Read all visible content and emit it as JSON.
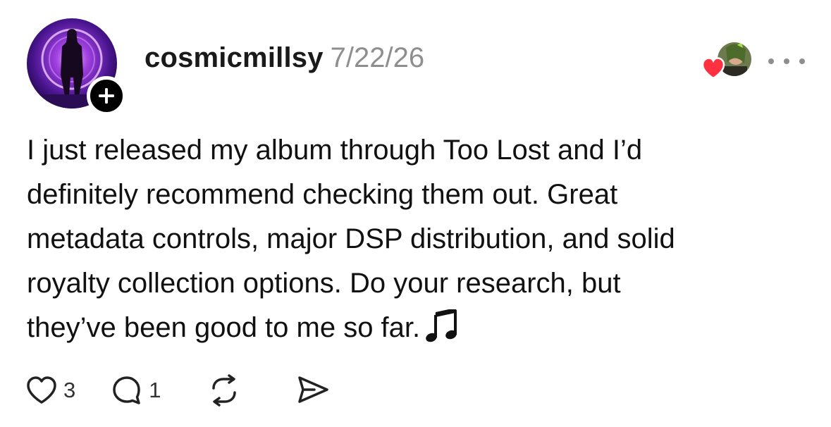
{
  "post": {
    "username": "cosmicmillsy",
    "timestamp": "7/22/26",
    "body_lines": [
      "I just released my album through Too Lost and I’d",
      "definitely recommend checking them out. Great",
      "metadata controls, major DSP distribution, and solid",
      "royalty collection options. Do your research, but",
      "they’ve been good to me so far."
    ],
    "emoji": "music-note-icon"
  },
  "actions": {
    "likes": "3",
    "comments": "1"
  },
  "icons": {
    "follow": "plus-icon",
    "like": "heart-icon",
    "comment": "comment-bubble-icon",
    "repost": "repost-icon",
    "share": "send-icon",
    "more": "more-icon",
    "liker_badge": "heart-icon"
  },
  "colors": {
    "accent_heart": "#ff3040",
    "text": "#111111",
    "muted": "#8e8e8e"
  }
}
